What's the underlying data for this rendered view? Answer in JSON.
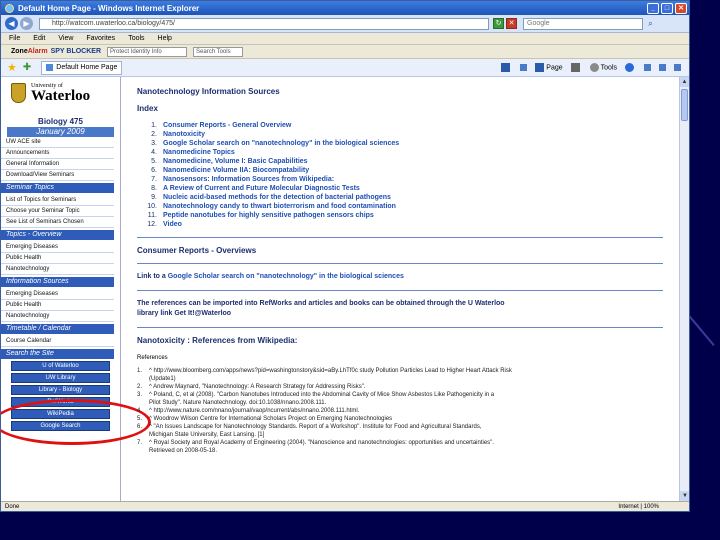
{
  "browser": {
    "title": "Default Home Page - Windows Internet Explorer",
    "url": "http://watcom.uwaterloo.ca/biology/475/",
    "search_placeholder": "Google",
    "menu": [
      "File",
      "Edit",
      "View",
      "Favorites",
      "Tools",
      "Help"
    ],
    "zonealarm": {
      "brand_zone": "Zone",
      "brand_alarm": "Alarm",
      "product": "SPY BLOCKER",
      "field1": "Protect Identity Info",
      "field2": "Search Tools"
    },
    "tab_label": "Default Home Page",
    "commands": {
      "page": "Page",
      "tools": "Tools"
    },
    "status_left": "Done",
    "status_right": "Internet | 100%"
  },
  "sidebar": {
    "university_small": "University of",
    "university": "Waterloo",
    "course": "Biology 475",
    "term": "January 2009",
    "links_top": [
      "UW ACE site",
      "Announcements",
      "General Information",
      "Download/View Seminars"
    ],
    "seminar_head": "Seminar Topics",
    "seminar_links": [
      "List of Topics for Seminars",
      "Choose your Seminar Topic",
      "See List of Seminars Chosen"
    ],
    "topics_head": "Topics - Overview",
    "topic_links": [
      "Emerging Diseases",
      "Public Health",
      "Nanotechnology"
    ],
    "info_head": "Information Sources",
    "info_links": [
      "Emerging Diseases",
      "Public Health",
      "Nanotechnology"
    ],
    "timetable_head": "Timetable / Calendar",
    "timetable_links": [
      "Course Calendar"
    ],
    "search_head": "Search the Site",
    "buttons": [
      "U of Waterloo",
      "UW Library",
      "Library - Biology",
      "RefWorks",
      "WikiPedia",
      "Google Search"
    ]
  },
  "main": {
    "page_title": "Nanotechnology Information Sources",
    "index_title": "Index",
    "index": [
      {
        "n": "1.",
        "t": "Consumer Reports - General Overview"
      },
      {
        "n": "2.",
        "t": "Nanotoxicity"
      },
      {
        "n": "3.",
        "t": "Google Scholar search on \"nanotechnology\" in the biological sciences"
      },
      {
        "n": "4.",
        "t": "Nanomedicine Topics"
      },
      {
        "n": "5.",
        "t": "Nanomedicine, Volume I: Basic Capabilities"
      },
      {
        "n": "6.",
        "t": "Nanomedicine Volume IIA: Biocompatability"
      },
      {
        "n": "7.",
        "t": "Nanosensors: Information Sources from Wikipedia:"
      },
      {
        "n": "8.",
        "t": "A Review of Current and Future Molecular Diagnostic Tests"
      },
      {
        "n": "9.",
        "t": "Nucleic acid-based methods for the detection of bacterial pathogens"
      },
      {
        "n": "10.",
        "t": "Nanotechnology candy to thwart bioterrorism and food contamination"
      },
      {
        "n": "11.",
        "t": "Peptide nanotubes for highly sensitive pathogen sensors chips"
      },
      {
        "n": "12.",
        "t": "Video"
      }
    ],
    "consumer_title": "Consumer Reports - Overviews",
    "scholar_prefix": "Link to a ",
    "scholar_link": "Google Scholar search on \"nanotechnology\" in the biological sciences",
    "refworks_text_1": "The references can be imported into RefWorks and articles and books can be obtained through the U Waterloo",
    "refworks_text_2": "library link Get It!@Waterloo",
    "nanotox_title": "Nanotoxicity : References from Wikipedia:",
    "references_label": "References",
    "references": [
      {
        "n": "1.",
        "t": "^ http://www.bloomberg.com/apps/news?pid=washingtonstory&sid=aBy.LhTf0c study Pollution Particles Lead to Higher Heart Attack Risk"
      },
      {
        "n": "",
        "t": "(Update1)"
      },
      {
        "n": "2.",
        "t": "^ Andrew Maynard, \"Nanotechnology: A Research Strategy for Addressing Risks\"."
      },
      {
        "n": "3.",
        "t": "^ Poland, C, et al (2008). \"Carbon Nanotubes Introduced into the Abdominal Cavity of Mice Show Asbestos Like Pathogenicity in a"
      },
      {
        "n": "",
        "t": "Pilot Study\". Nature Nanotechnology. doi:10.1038/nnano.2008.111."
      },
      {
        "n": "4.",
        "t": "^ http://www.nature.com/nnano/journal/vaop/ncurrent/abs/nnano.2008.111.html."
      },
      {
        "n": "5.",
        "t": "^ Woodrow Wilson Centre for International Scholars Project on Emerging Nanotechnologies"
      },
      {
        "n": "6.",
        "t": "^ \"An Issues Landscape for Nanotechnology Standards. Report of a Workshop\". Institute for Food and Agricultural Standards,"
      },
      {
        "n": "",
        "t": "Michigan State University, East Lansing. [1]"
      },
      {
        "n": "7.",
        "t": "^ Royal Society and Royal Academy of Engineering (2004). \"Nanoscience and nanotechnologies: opportunities and uncertainties\"."
      },
      {
        "n": "",
        "t": "Retrieved on 2008-05-18."
      }
    ]
  }
}
